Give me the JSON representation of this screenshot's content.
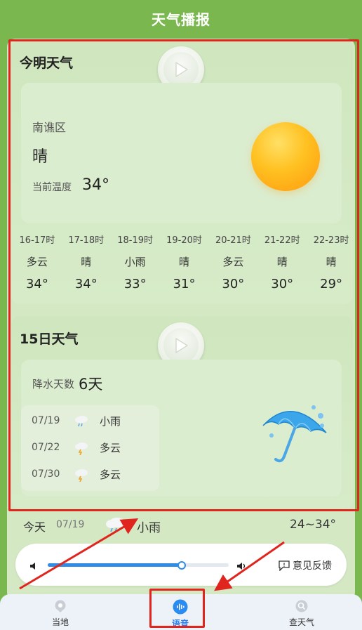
{
  "header": {
    "title": "天气播报"
  },
  "today_card": {
    "title": "今明天气",
    "district": "南谯区",
    "weather": "晴",
    "temp_label": "当前温度",
    "temp_value": "34°",
    "hours": [
      {
        "time": "16-17时",
        "weather": "多云",
        "temp": "34°"
      },
      {
        "time": "17-18时",
        "weather": "晴",
        "temp": "34°"
      },
      {
        "time": "18-19时",
        "weather": "小雨",
        "temp": "33°"
      },
      {
        "time": "19-20时",
        "weather": "晴",
        "temp": "31°"
      },
      {
        "time": "20-21时",
        "weather": "多云",
        "temp": "30°"
      },
      {
        "time": "21-22时",
        "weather": "晴",
        "temp": "30°"
      },
      {
        "time": "22-23时",
        "weather": "晴",
        "temp": "29°"
      }
    ]
  },
  "forecast_card": {
    "title": "15日天气",
    "rain_label": "降水天数",
    "rain_value": "6天",
    "items": [
      {
        "date": "07/19",
        "weather": "小雨",
        "icon": "rain-cloud-icon"
      },
      {
        "date": "07/22",
        "weather": "多云",
        "icon": "thunder-cloud-icon"
      },
      {
        "date": "07/30",
        "weather": "多云",
        "icon": "thunder-cloud-icon"
      }
    ]
  },
  "today_row": {
    "label": "今天",
    "date": "07/19",
    "weather": "小雨",
    "range": "24~34°",
    "icon": "rain-cloud-icon"
  },
  "player": {
    "progress": 0.74,
    "feedback_label": "意见反馈"
  },
  "nav": {
    "items": [
      {
        "label": "当地",
        "icon": "location-icon",
        "active": false
      },
      {
        "label": "语音",
        "icon": "voice-icon",
        "active": true
      },
      {
        "label": "查天气",
        "icon": "search-weather-icon",
        "active": false
      }
    ]
  },
  "colors": {
    "header_bg": "#7ab84f",
    "accent": "#2e8be8",
    "annotation": "#e0251f"
  }
}
